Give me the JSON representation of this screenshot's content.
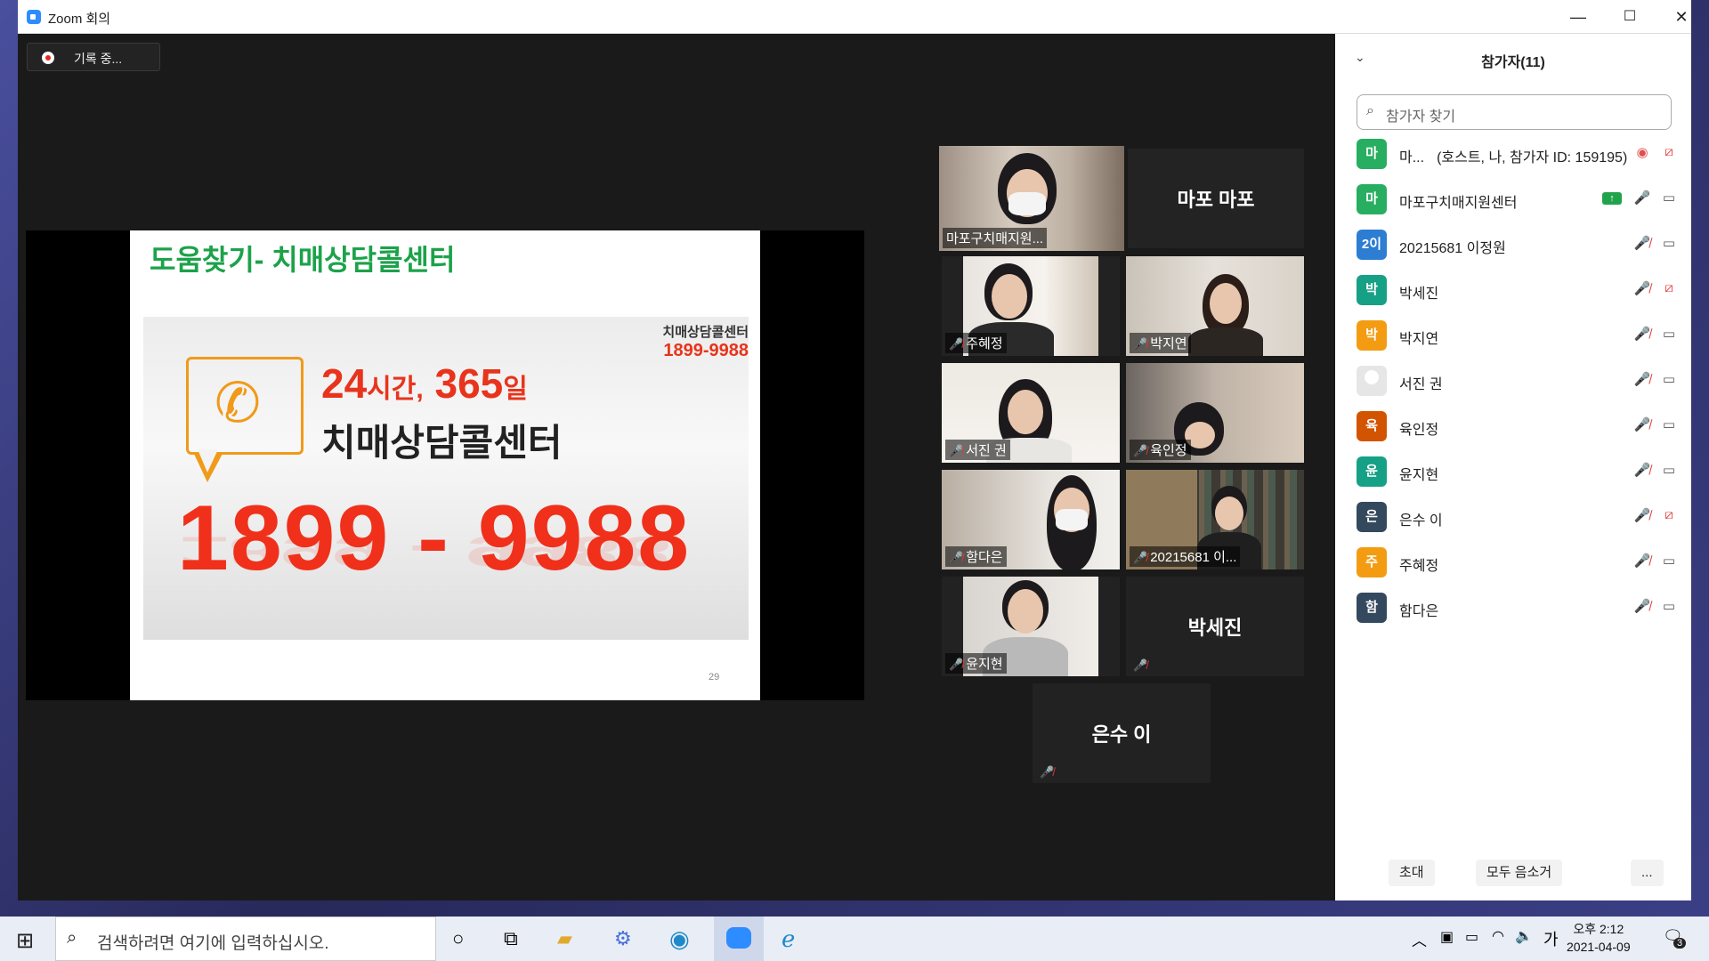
{
  "window": {
    "title": "Zoom 회의",
    "controls": [
      "—",
      "☐",
      "✕"
    ]
  },
  "recording": {
    "label": "기록 중..."
  },
  "slide": {
    "title": "도움찾기- 치매상담콜센터",
    "corner_title": "치매상담콜센터",
    "corner_number": "1899-9988",
    "hours_a": "24",
    "hours_a_unit": "시간,",
    "hours_b": "365",
    "hours_b_unit": "일",
    "center": "치매상담콜센터",
    "big_number": "1899 - 9988",
    "page": "29"
  },
  "gallery": [
    {
      "name": "마포구치매지원...",
      "active": true,
      "muted": false
    },
    {
      "name": "마포 마포",
      "video": false
    },
    {
      "name": "주혜정",
      "muted": true
    },
    {
      "name": "박지연",
      "muted": true
    },
    {
      "name": "서진 권",
      "muted": true
    },
    {
      "name": "육인정",
      "muted": true
    },
    {
      "name": "함다은",
      "muted": true
    },
    {
      "name": "20215681 이...",
      "muted": true
    },
    {
      "name": "윤지현",
      "muted": true
    },
    {
      "name": "박세진",
      "video": false,
      "muted": true
    },
    {
      "name": "은수 이",
      "video": false,
      "muted": true
    }
  ],
  "participants_panel": {
    "title": "참가자(11)",
    "search_placeholder": "참가자 찾기",
    "list": [
      {
        "avatar": "마",
        "color": "#27ae60",
        "name": "마...",
        "extra": "(호스트, 나, 참가자 ID: 159195)",
        "mic": "record",
        "cam": "off"
      },
      {
        "avatar": "마",
        "color": "#27ae60",
        "name": "마포구치매지원센터",
        "share": true,
        "mic": "on",
        "cam": "on"
      },
      {
        "avatar": "2이",
        "color": "#2d7dd2",
        "name": "20215681 이정원",
        "mic": "off",
        "cam": "on"
      },
      {
        "avatar": "박",
        "color": "#16a085",
        "name": "박세진",
        "mic": "off",
        "cam": "off"
      },
      {
        "avatar": "박",
        "color": "#f39c12",
        "name": "박지연",
        "mic": "off",
        "cam": "on"
      },
      {
        "avatar": "",
        "color": "",
        "name": "서진 권",
        "mic": "off",
        "cam": "on"
      },
      {
        "avatar": "육",
        "color": "#d35400",
        "name": "육인정",
        "mic": "off",
        "cam": "on"
      },
      {
        "avatar": "윤",
        "color": "#16a085",
        "name": "윤지현",
        "mic": "off",
        "cam": "on"
      },
      {
        "avatar": "은",
        "color": "#34495e",
        "name": "은수 이",
        "mic": "off",
        "cam": "off"
      },
      {
        "avatar": "주",
        "color": "#f39c12",
        "name": "주혜정",
        "mic": "off",
        "cam": "on"
      },
      {
        "avatar": "함",
        "color": "#34495e",
        "name": "함다은",
        "mic": "off",
        "cam": "on"
      }
    ],
    "buttons": {
      "invite": "초대",
      "mute_all": "모두 음소거",
      "more": "..."
    }
  },
  "taskbar": {
    "search_placeholder": "검색하려면 여기에 입력하십시오.",
    "ime": "가",
    "time": "오후 2:12",
    "date": "2021-04-09",
    "notifications": "3"
  }
}
